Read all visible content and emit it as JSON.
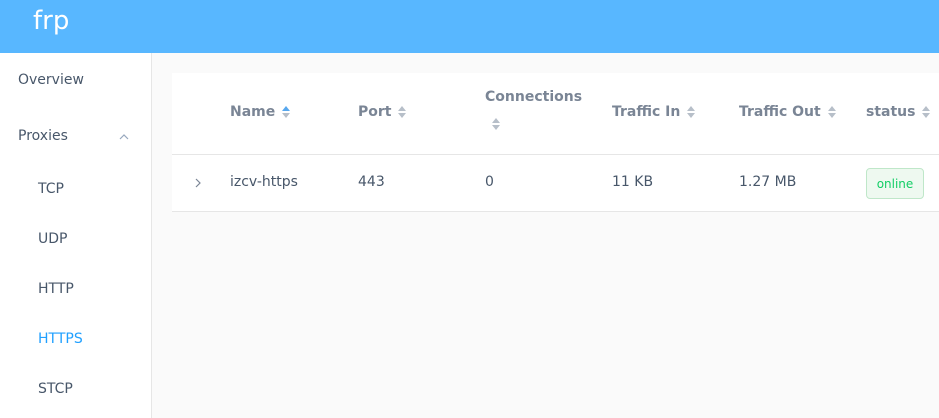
{
  "header": {
    "brand": "frp"
  },
  "sidebar": {
    "overview": "Overview",
    "proxies": "Proxies",
    "sub_items": [
      "TCP",
      "UDP",
      "HTTP",
      "HTTPS",
      "STCP"
    ],
    "active": "HTTPS"
  },
  "table": {
    "columns": [
      "Name",
      "Port",
      "Connections",
      "Traffic In",
      "Traffic Out",
      "status"
    ],
    "rows": [
      {
        "name": "izcv-https",
        "port": "443",
        "connections": "0",
        "traffic_in": "11 KB",
        "traffic_out": "1.27 MB",
        "status": "online"
      }
    ]
  },
  "colors": {
    "header": "#58b7ff",
    "active": "#20a0ff",
    "status_online": "#13ce66"
  }
}
